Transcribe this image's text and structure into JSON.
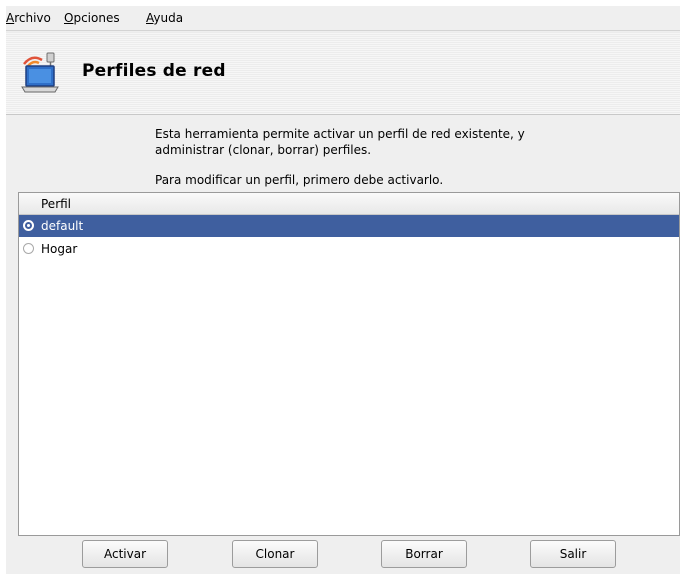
{
  "menubar": {
    "items": [
      {
        "mnemonic": "A",
        "rest": "rchivo"
      },
      {
        "mnemonic": "O",
        "rest": "pciones"
      },
      {
        "mnemonic": "A",
        "rest": "yuda"
      }
    ]
  },
  "banner": {
    "icon": "network-profile-icon",
    "title": "Perfiles de red"
  },
  "description": {
    "line1": "Esta herramienta permite activar un perfil de red existente, y",
    "line2": "administrar (clonar, borrar) perfiles.",
    "line3": "Para modificar un perfil, primero debe activarlo."
  },
  "profile_list": {
    "header": "Perfil",
    "rows": [
      {
        "label": "default",
        "selected": true
      },
      {
        "label": "Hogar",
        "selected": false
      }
    ]
  },
  "buttons": {
    "activate": "Activar",
    "clone": "Clonar",
    "delete": "Borrar",
    "quit": "Salir"
  },
  "colors": {
    "selection": "#3f5f9f",
    "window_bg": "#efefef"
  }
}
